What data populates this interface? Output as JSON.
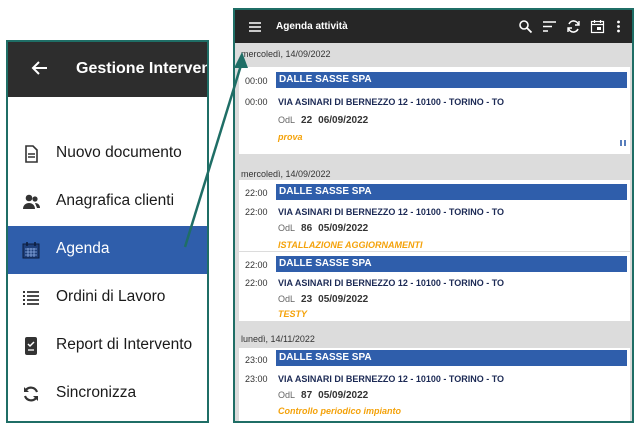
{
  "drawer": {
    "title": "Gestione Intervent",
    "items": [
      {
        "label": "Nuovo documento",
        "icon": "document-icon"
      },
      {
        "label": "Anagrafica clienti",
        "icon": "people-icon"
      },
      {
        "label": "Agenda",
        "icon": "calendar-icon",
        "active": true
      },
      {
        "label": "Ordini di Lavoro",
        "icon": "list-icon"
      },
      {
        "label": "Report di Intervento",
        "icon": "report-icon"
      },
      {
        "label": "Sincronizza",
        "icon": "sync-icon"
      }
    ]
  },
  "agenda": {
    "title": "Agenda attività",
    "days": [
      {
        "label": "mercoledì, 14/09/2022",
        "entries": [
          {
            "time1": "00:00",
            "company": "DALLE SASSE SPA",
            "time2": "00:00",
            "address": "VIA ASINARI DI BERNEZZO 12 - 10100 - TORINO - TO",
            "odl_label": "OdL",
            "odl_number": "22",
            "date": "06/09/2022",
            "note": "prova"
          }
        ]
      },
      {
        "label": "mercoledì, 14/09/2022",
        "entries": [
          {
            "time1": "22:00",
            "company": "DALLE SASSE SPA",
            "time2": "22:00",
            "address": "VIA ASINARI DI BERNEZZO 12 - 10100 - TORINO - TO",
            "odl_label": "OdL",
            "odl_number": "86",
            "date": "05/09/2022",
            "note": "ISTALLAZIONE AGGIORNAMENTI"
          },
          {
            "time1": "22:00",
            "company": "DALLE SASSE SPA",
            "time2": "22:00",
            "address": "VIA ASINARI DI BERNEZZO 12 - 10100 - TORINO - TO",
            "odl_label": "OdL",
            "odl_number": "23",
            "date": "05/09/2022",
            "note": "TESTY"
          }
        ]
      },
      {
        "label": "lunedì, 14/11/2022",
        "entries": [
          {
            "time1": "23:00",
            "company": "DALLE SASSE SPA",
            "time2": "23:00",
            "address": "VIA ASINARI DI BERNEZZO 12 - 10100 - TORINO - TO",
            "odl_label": "OdL",
            "odl_number": "87",
            "date": "05/09/2022",
            "note": "Controllo periodico impianto"
          }
        ]
      }
    ]
  },
  "colors": {
    "accent": "#2f5eab",
    "frame": "#1f6e66",
    "note": "#f4a20a",
    "bar": "#262626"
  }
}
